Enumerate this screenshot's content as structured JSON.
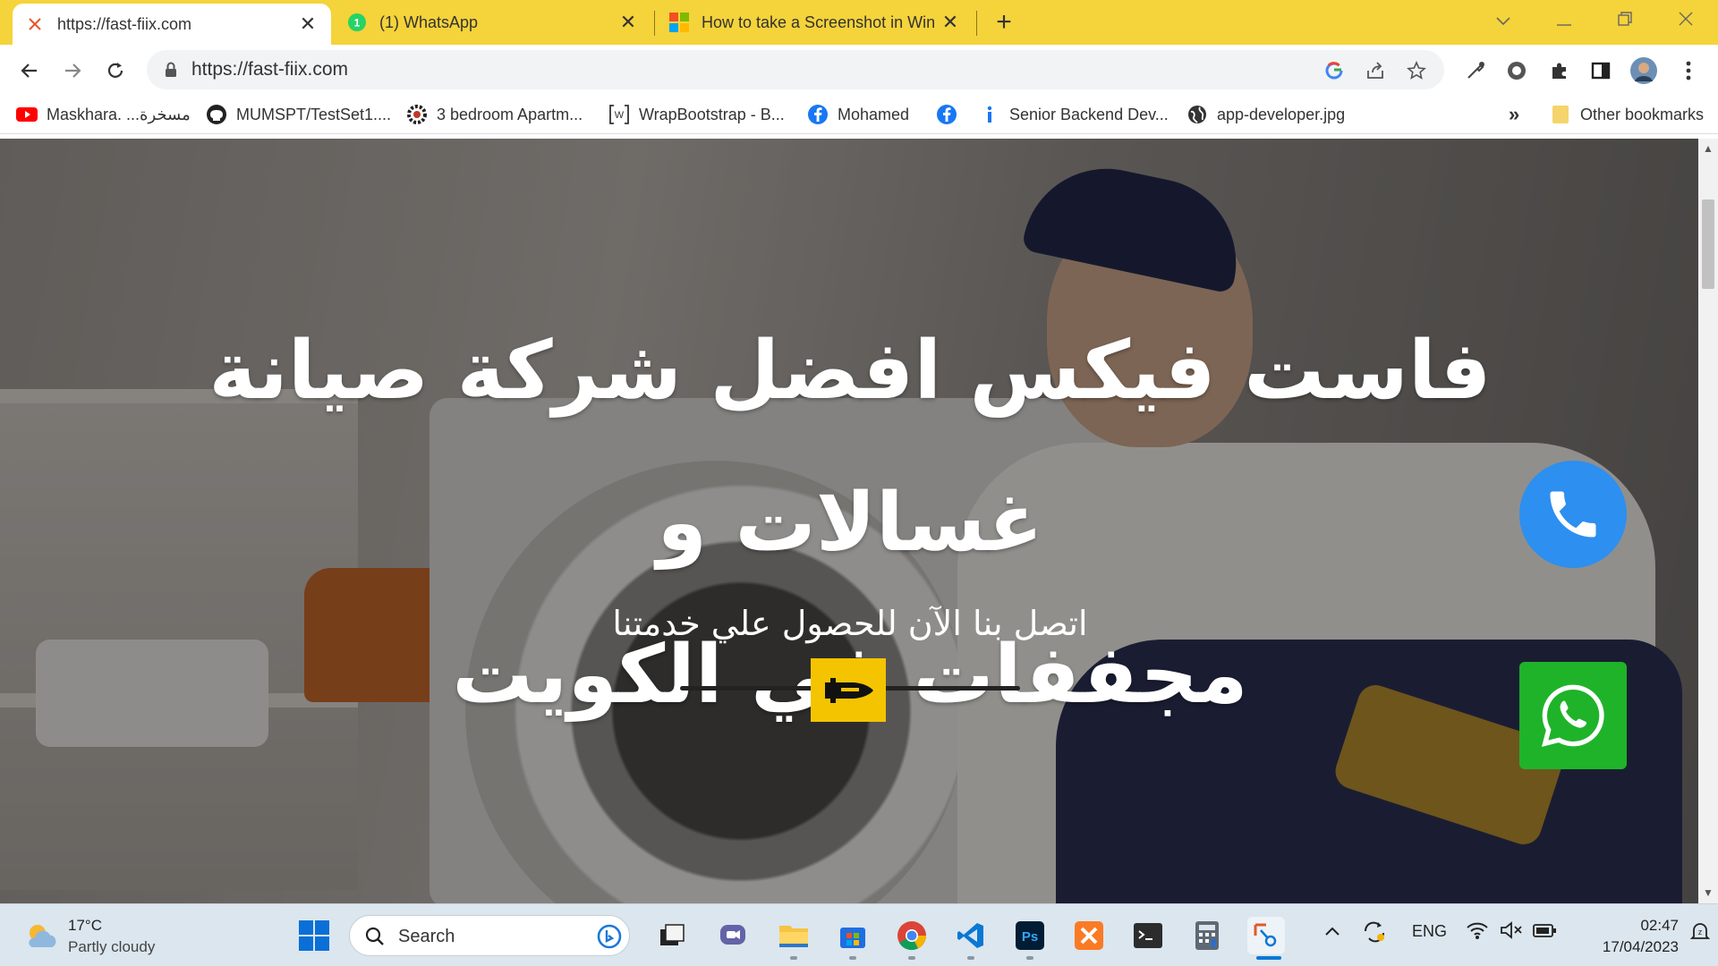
{
  "browser": {
    "tabs": [
      {
        "title": "https://fast-fiix.com",
        "active": true
      },
      {
        "title": "(1) WhatsApp",
        "badge": "1",
        "active": false
      },
      {
        "title": "How to take a Screenshot in Win",
        "active": false
      }
    ],
    "url": "https://fast-fiix.com",
    "bookmarks": [
      {
        "label": "Maskhara. ...مسخرة",
        "icon": "youtube-icon"
      },
      {
        "label": "MUMSPT/TestSet1....",
        "icon": "github-icon"
      },
      {
        "label": "3 bedroom Apartm...",
        "icon": "gear-icon"
      },
      {
        "label": "WrapBootstrap - B...",
        "icon": "wrapbootstrap-icon"
      },
      {
        "label": "Mohamed",
        "icon": "facebook-icon"
      },
      {
        "label": "",
        "icon": "facebook-icon"
      },
      {
        "label": "Senior Backend Dev...",
        "icon": "info-icon"
      },
      {
        "label": "app-developer.jpg",
        "icon": "globe-icon"
      }
    ],
    "more_bookmarks": "»",
    "other_bookmarks": "Other bookmarks"
  },
  "hero": {
    "title_line1": "فاست فيكس افضل شركة صيانة غسالات و",
    "title_line2": "مجففات في الكويت",
    "subtitle": "اتصل بنا الآن للحصول علي خدمتنا"
  },
  "taskbar": {
    "weather_temp": "17°C",
    "weather_desc": "Partly cloudy",
    "search_label": "Search",
    "language": "ENG",
    "time": "02:47",
    "date": "17/04/2023"
  },
  "colors": {
    "tabstrip": "#f5d33a",
    "phone_button": "#2d8ff0",
    "whatsapp_button": "#1fb32a",
    "divider_badge": "#f5c400"
  }
}
